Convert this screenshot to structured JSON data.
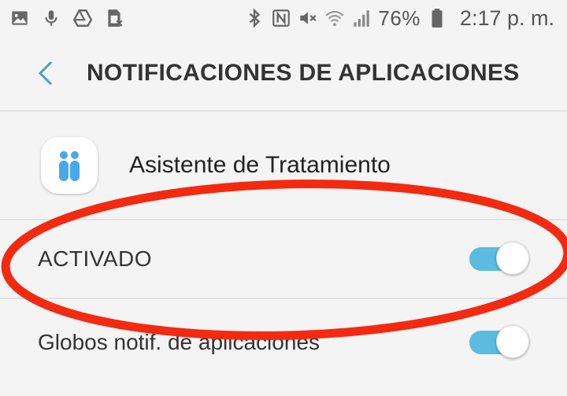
{
  "status_bar": {
    "icons_left": [
      "image-icon",
      "microphone-icon",
      "drive-icon",
      "sim-card-icon"
    ],
    "icons_right": [
      "bluetooth-icon",
      "nfc-icon",
      "mute-icon",
      "wifi-icon",
      "signal-icon"
    ],
    "battery": "76%",
    "time": "2:17 p. m."
  },
  "header": {
    "title": "NOTIFICACIONES DE APLICACIONES",
    "back_icon": "chevron-left-icon"
  },
  "app": {
    "name": "Asistente de Tratamiento",
    "icon": "people-icon"
  },
  "settings": [
    {
      "label": "ACTIVADO",
      "enabled": true
    },
    {
      "label": "Globos notif. de aplicaciones",
      "enabled": true
    }
  ],
  "colors": {
    "toggle_on": "#5bbbe0",
    "annotation": "#f32a10",
    "app_icon": "#4aa8e8"
  }
}
